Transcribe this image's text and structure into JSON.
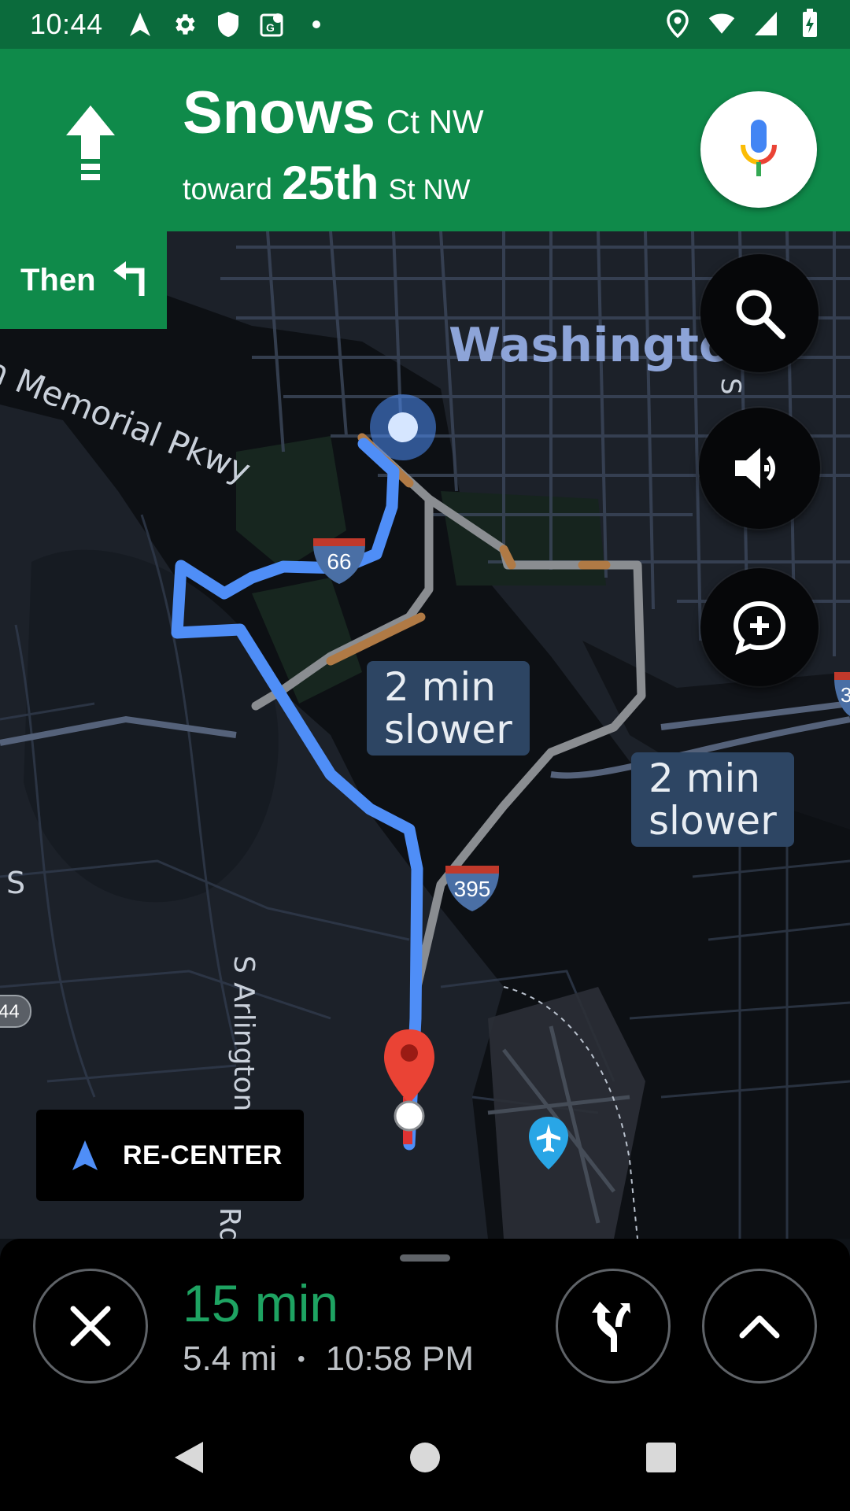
{
  "status_bar": {
    "time": "10:44",
    "left_icons": [
      "navigation-arrow-icon",
      "settings-icon",
      "shield-icon",
      "maps-icon",
      "dot-icon"
    ],
    "right_icons": [
      "location-pin-icon",
      "wifi-icon",
      "cell-signal-icon",
      "battery-icon"
    ]
  },
  "nav_header": {
    "street": "Snows",
    "street_suffix": "Ct NW",
    "toward_word": "toward",
    "toward_street": "25th",
    "toward_suffix": "St NW",
    "maneuver_icon": "straight-arrow-icon"
  },
  "then_chip": {
    "label": "Then",
    "icon": "turn-left-icon"
  },
  "map": {
    "city_label": "Washington",
    "parkway_label": "n Memorial Pkwy",
    "arlington_label": "S Arlington",
    "rd_label": "Rd",
    "s_label": "S",
    "side_s_label": "S",
    "shields": [
      "66",
      "395",
      "44",
      "3"
    ],
    "alternates": [
      {
        "line1": "2 min",
        "line2": "slower"
      },
      {
        "line1": "2 min",
        "line2": "slower"
      }
    ]
  },
  "fabs": {
    "search": "search-icon",
    "sound": "volume-icon",
    "report": "add-report-icon"
  },
  "recenter": {
    "label": "RE-CENTER"
  },
  "bottom": {
    "eta_time": "15 min",
    "distance": "5.4 mi",
    "separator": "•",
    "arrival": "10:58 PM"
  },
  "colors": {
    "header_green": "#0f8a4a",
    "status_green": "#0b6b3c",
    "route_blue": "#4f8ef7",
    "alt_route_gray": "#8a8d91",
    "eta_green": "#1ea362",
    "destination_red": "#ea4335"
  }
}
